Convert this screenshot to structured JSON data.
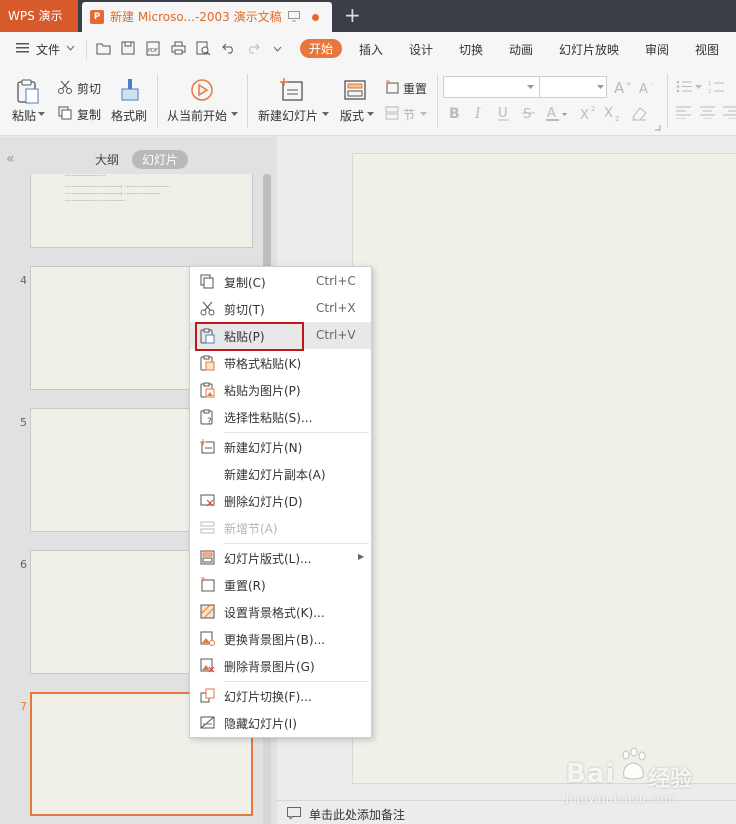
{
  "titlebar": {
    "app_name": "WPS 演示",
    "doc_title": "新建 Microso...-2003 演示文稿",
    "new_tab": "+"
  },
  "menubar": {
    "file": "文件",
    "tabs": [
      "开始",
      "插入",
      "设计",
      "切换",
      "动画",
      "幻灯片放映",
      "审阅",
      "视图"
    ],
    "active_tab": "开始"
  },
  "ribbon": {
    "paste": "粘贴",
    "cut": "剪切",
    "copy": "复制",
    "format_painter": "格式刷",
    "from_current": "从当前开始",
    "new_slide": "新建幻灯片",
    "layout": "版式",
    "reset": "重置",
    "section": "节"
  },
  "left_panel": {
    "outline_tab": "大纲",
    "slides_tab": "幻灯片",
    "slide_numbers": [
      "4",
      "5",
      "6",
      "7"
    ],
    "thumb3_lines": [
      "……………………………………………",
      "……………………",
      "    ……………………………，………………………",
      "……………………………，…………………",
      "………………………………"
    ]
  },
  "notes": {
    "placeholder": "单击此处添加备注"
  },
  "context_menu": {
    "items": [
      {
        "label": "复制(C)",
        "shortcut": "Ctrl+C",
        "icon": "copy-icon"
      },
      {
        "label": "剪切(T)",
        "shortcut": "Ctrl+X",
        "icon": "cut-icon"
      },
      {
        "label": "粘贴(P)",
        "shortcut": "Ctrl+V",
        "icon": "paste-icon",
        "highlighted": true
      },
      {
        "label": "带格式粘贴(K)",
        "icon": "paste-format-icon"
      },
      {
        "label": "粘贴为图片(P)",
        "icon": "paste-picture-icon"
      },
      {
        "label": "选择性粘贴(S)...",
        "icon": "paste-special-icon"
      },
      {
        "label": "新建幻灯片(N)",
        "icon": "new-slide-icon"
      },
      {
        "label": "新建幻灯片副本(A)",
        "icon": ""
      },
      {
        "label": "删除幻灯片(D)",
        "icon": "delete-slide-icon"
      },
      {
        "label": "新增节(A)",
        "icon": "section-icon",
        "disabled": true
      },
      {
        "label": "幻灯片版式(L)...",
        "icon": "layout-icon",
        "submenu": true
      },
      {
        "label": "重置(R)",
        "icon": "reset-icon"
      },
      {
        "label": "设置背景格式(K)...",
        "icon": "background-format-icon"
      },
      {
        "label": "更换背景图片(B)...",
        "icon": "change-bg-image-icon"
      },
      {
        "label": "删除背景图片(G)",
        "icon": "delete-bg-image-icon"
      },
      {
        "label": "幻灯片切换(F)...",
        "icon": "transition-icon"
      },
      {
        "label": "隐藏幻灯片(I)",
        "icon": "hide-slide-icon"
      }
    ]
  },
  "watermark": {
    "logo_text": "Bai",
    "brand": "经验",
    "url": "jingyan.baidu.com"
  },
  "colors": {
    "accent": "#e8773e",
    "highlight_box": "#c0161c",
    "titlebar": "#3a3f47"
  }
}
